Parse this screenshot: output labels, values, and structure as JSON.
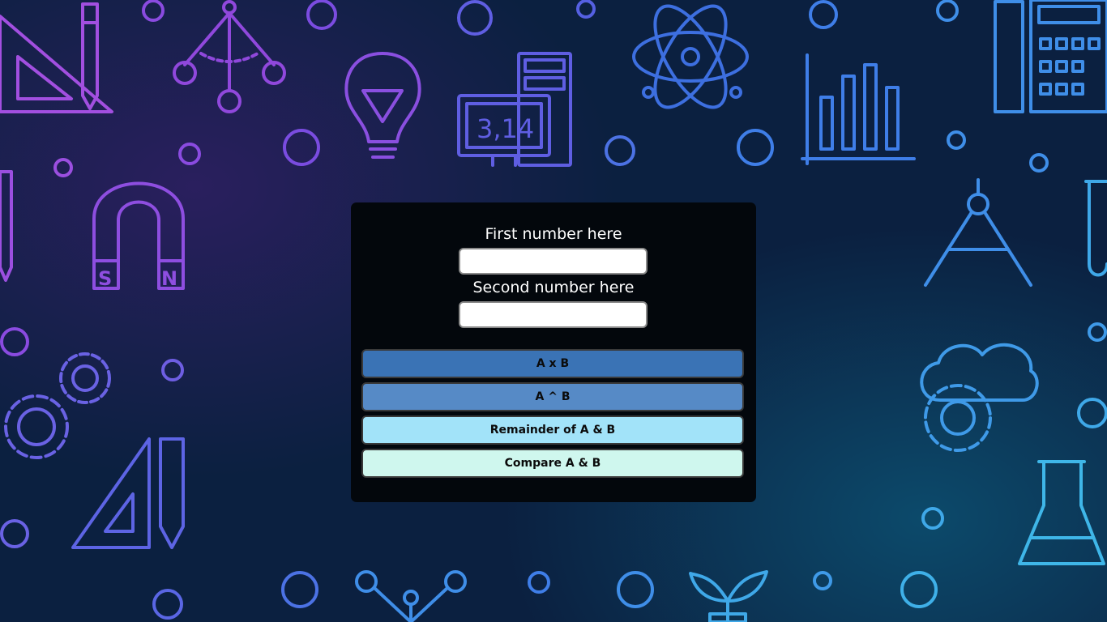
{
  "form": {
    "first_label": "First number here",
    "first_value": "",
    "second_label": "Second number here",
    "second_value": ""
  },
  "buttons": [
    {
      "label": "A x B",
      "color": "#3a73b5"
    },
    {
      "label": "A ^ B",
      "color": "#568ac6"
    },
    {
      "label": "Remainder of A & B",
      "color": "#a2e3f9"
    },
    {
      "label": "Compare A & B",
      "color": "#cff7ee"
    }
  ],
  "background": {
    "base_color": "#0b2040",
    "icon_colors": [
      "#9b4fe0",
      "#6a6ae6",
      "#3f8ee8",
      "#3fb6e8"
    ],
    "calculator_display": "3,14",
    "magnet_letters": [
      "S",
      "N"
    ],
    "icons": [
      "set-square-icon",
      "pencil-icon",
      "pendulum-icon",
      "lightbulb-icon",
      "calculator-display-icon",
      "atom-icon",
      "bar-chart-icon",
      "ruler-calculator-icon",
      "magnet-icon",
      "compass-icon",
      "test-tube-icon",
      "gears-icon",
      "cloud-gear-icon",
      "flask-icon",
      "plant-icon",
      "molecule-icon"
    ]
  }
}
